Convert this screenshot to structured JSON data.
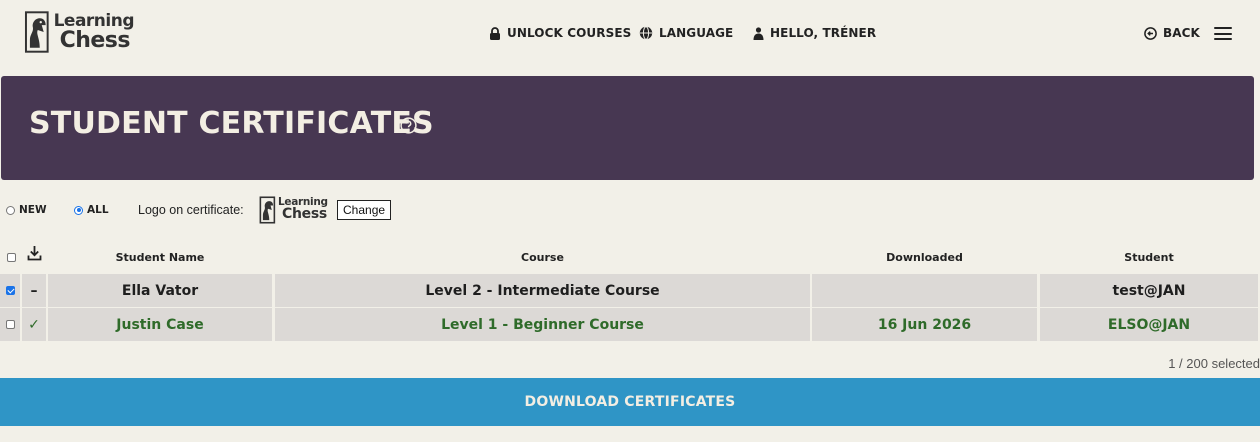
{
  "domain": "Computer-Use",
  "brand": {
    "logo_line1": "Learning",
    "logo_line2": "Chess"
  },
  "nav": {
    "unlock": "UNLOCK COURSES",
    "language": "LANGUAGE",
    "hello": "HELLO, TRÉNER",
    "back": "BACK"
  },
  "banner": {
    "title": "STUDENT CERTIFICATES"
  },
  "filters": {
    "new_label": "NEW",
    "all_label": "ALL",
    "selected": "ALL",
    "logo_label": "Logo on certificate:",
    "change_label": "Change"
  },
  "table": {
    "headers": {
      "name": "Student Name",
      "course": "Course",
      "downloaded": "Downloaded",
      "student": "Student"
    },
    "rows": [
      {
        "checked": true,
        "status": "–",
        "name": "Ella Vator",
        "course": "Level 2 - Intermediate Course",
        "downloaded": "",
        "student": "test@JAN",
        "done": false
      },
      {
        "checked": false,
        "status": "✓",
        "name": "Justin Case",
        "course": "Level 1 - Beginner Course",
        "downloaded": "16 Jun 2026",
        "student": "ELSO@JAN",
        "done": true
      }
    ]
  },
  "selection": {
    "count_text": "1 / 200 selected"
  },
  "actions": {
    "download_label": "DOWNLOAD CERTIFICATES"
  },
  "colors": {
    "banner": "#473752",
    "button": "#2f95c6",
    "row": "#dcd9d6",
    "done_text": "#2f6b2a",
    "page_bg": "#f2f0e8"
  }
}
